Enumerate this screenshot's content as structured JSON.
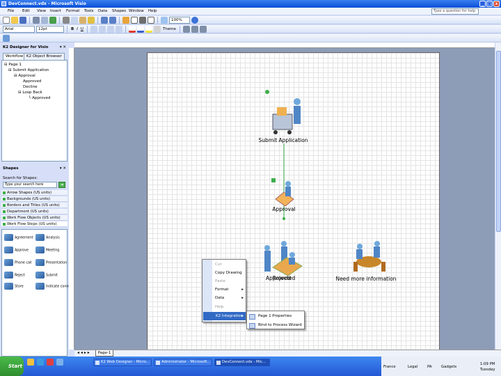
{
  "window": {
    "title": "DevConnect.vdx - Microsoft Visio",
    "minimize": "_",
    "maximize": "□",
    "close": "x"
  },
  "menu": {
    "items": [
      "File",
      "Edit",
      "View",
      "Insert",
      "Format",
      "Tools",
      "Data",
      "Shapes",
      "Window",
      "Help"
    ],
    "help_placeholder": "Type a question for help"
  },
  "toolbar": {
    "zoom": "100%",
    "font": "Arial",
    "size": "12pt",
    "themes_label": "Theme",
    "standard_icons": [
      "new",
      "open",
      "save",
      "print",
      "preview",
      "spell",
      "cut",
      "copy",
      "paste",
      "format-painter",
      "undo",
      "redo",
      "connector",
      "text",
      "pointer",
      "zoom",
      "help"
    ],
    "format_icons": [
      "bold",
      "italic",
      "underline",
      "align-left",
      "align-center",
      "align-right",
      "font-color",
      "line-color",
      "fill-color"
    ]
  },
  "left_pane": {
    "designer_title": "K2 Designer for Visio",
    "tabs": [
      "Workflow",
      "K2 Object Browser"
    ],
    "tree": [
      "Page 1",
      "Submit Application",
      "Approval",
      "Approved",
      "Decline",
      "Loop Back",
      "Approved"
    ],
    "shapes_title": "Shapes",
    "search_label": "Search for Shapes:",
    "search_placeholder": "Type your search here",
    "stencils": [
      "Arrow Shapes (US units)",
      "Backgrounds (US units)",
      "Borders and Titles (US units)",
      "Department (US units)",
      "Work Flow Objects (US units)",
      "Work Flow Steps (US units)"
    ],
    "shapes": [
      "Agreement",
      "Analysis",
      "Approve",
      "Meeting",
      "Phone call",
      "Presentation",
      "Reject",
      "Submit",
      "Store",
      "Indicate connector"
    ]
  },
  "diagram": {
    "shapes": [
      "Submit Application",
      "Approval",
      "Approved",
      "Rejected",
      "Need more information"
    ]
  },
  "context_menu": {
    "items": [
      "Cut",
      "Copy Drawing",
      "Paste",
      "Format",
      "Data",
      "Help",
      "K2 Integration"
    ]
  },
  "submenu": {
    "items": [
      "Page 1 Properties",
      "Bind to Process Wizard"
    ]
  },
  "page_tab": "Page-1",
  "taskbar": {
    "start": "Start",
    "tasks": [
      "K2 Web Designer - Micro...",
      "Administrator - Microsoft...",
      "DevConnect.vdx - Mic..."
    ],
    "tray": [
      "France",
      "Legal",
      "PA",
      "Gadgets"
    ],
    "time": "1:09 PM",
    "day": "Tuesday"
  },
  "colors": {
    "titlebar": "#0a4fd6",
    "workspace": "#8d9db8",
    "connector": "#3cae4a",
    "taskbar": "#2457d4"
  }
}
